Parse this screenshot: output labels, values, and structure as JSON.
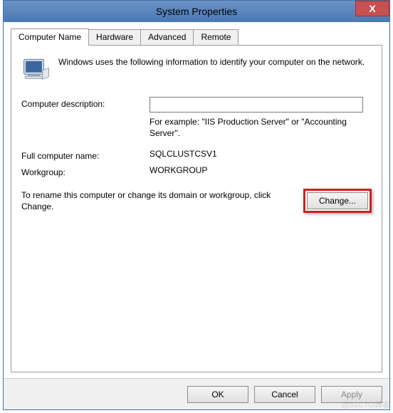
{
  "window": {
    "title": "System Properties",
    "close_symbol": "X"
  },
  "tabs": [
    {
      "label": "Computer Name",
      "active": true
    },
    {
      "label": "Hardware",
      "active": false
    },
    {
      "label": "Advanced",
      "active": false
    },
    {
      "label": "Remote",
      "active": false
    }
  ],
  "content": {
    "intro": "Windows uses the following information to identify your computer on the network.",
    "desc_label": "Computer description:",
    "desc_value": "",
    "example": "For example: \"IIS Production Server\" or \"Accounting Server\".",
    "fullname_label": "Full computer name:",
    "fullname_value": "SQLCLUSTCSV1",
    "workgroup_label": "Workgroup:",
    "workgroup_value": "WORKGROUP",
    "change_desc": "To rename this computer or change its domain or workgroup, click Change.",
    "change_button": "Change..."
  },
  "footer": {
    "ok": "OK",
    "cancel": "Cancel",
    "apply": "Apply"
  },
  "watermark": "@51CTO博客"
}
